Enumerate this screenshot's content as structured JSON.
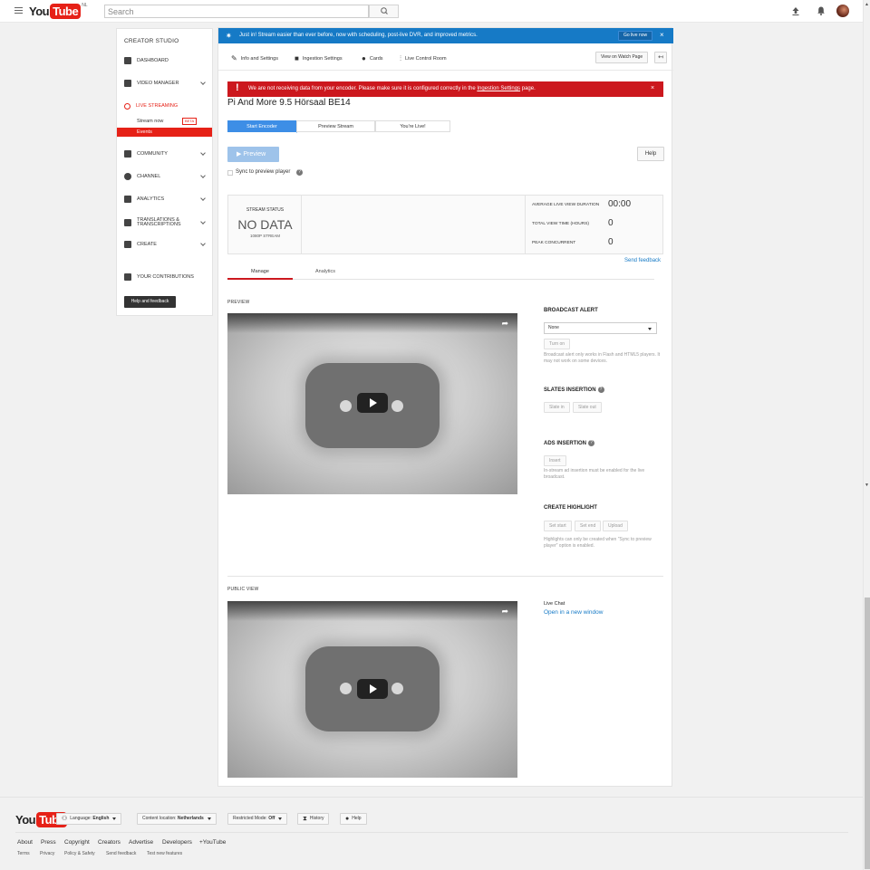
{
  "header": {
    "logo_you": "You",
    "logo_tube": "Tube",
    "logo_region": "NL",
    "search_placeholder": "Search"
  },
  "sidebar": {
    "title": "CREATOR STUDIO",
    "items": [
      {
        "label": "DASHBOARD"
      },
      {
        "label": "VIDEO MANAGER"
      },
      {
        "label": "LIVE STREAMING"
      },
      {
        "label": "COMMUNITY"
      },
      {
        "label": "CHANNEL"
      },
      {
        "label": "ANALYTICS"
      },
      {
        "label": "TRANSLATIONS &"
      },
      {
        "label": "TRANSCRIPTIONS"
      },
      {
        "label": "CREATE"
      },
      {
        "label": "YOUR CONTRIBUTIONS"
      }
    ],
    "sub_items": [
      {
        "label": "Stream now",
        "badge": "BETA"
      },
      {
        "label": "Events"
      }
    ],
    "help_button": "Help and feedback"
  },
  "announcement": {
    "text": "Just in! Stream easier than ever before, now with scheduling, post-live DVR, and improved metrics.",
    "button": "Go live now",
    "close": "×"
  },
  "toolbar": {
    "items": [
      {
        "label": "Info and Settings"
      },
      {
        "label": "Ingestion Settings"
      },
      {
        "label": "Cards"
      },
      {
        "label": "Live Control Room"
      }
    ],
    "view_watch": "View on Watch Page"
  },
  "error": {
    "text_before": "We are not receiving data from your encoder. Please make sure it is configured correctly in the ",
    "link": "Ingestion Settings",
    "text_after": " page.",
    "close": "×"
  },
  "stream": {
    "title": "Pi And More 9.5 Hörsaal BE14",
    "steps": [
      "Start Encoder",
      "Preview Stream",
      "You're Live!"
    ],
    "preview_button": "Preview",
    "help_button": "Help",
    "sync_label": "Sync to preview player"
  },
  "status": {
    "label": "STREAM STATUS",
    "value": "NO DATA",
    "resolution": "1080P STREAM",
    "stats": [
      {
        "label": "AVERAGE LIVE VIEW DURATION",
        "value": "00:00"
      },
      {
        "label": "TOTAL VIEW TIME (HOURS)",
        "value": "0"
      },
      {
        "label": "PEAK CONCURRENT",
        "value": "0"
      }
    ],
    "send_feedback": "Send feedback"
  },
  "tabs": [
    "Manage",
    "Analytics"
  ],
  "preview_section": {
    "label": "PREVIEW",
    "public_label": "PUBLIC VIEW"
  },
  "broadcast_alert": {
    "title": "BROADCAST ALERT",
    "selected": "None",
    "button": "Turn on",
    "note": "Broadcast alert only works in Flash and HTML5 players. It may not work on some devices."
  },
  "slates": {
    "title": "SLATES INSERTION",
    "buttons": [
      "Slate in",
      "Slate out"
    ]
  },
  "ads": {
    "title": "ADS INSERTION",
    "button": "Insert",
    "note": "In-stream ad insertion must be enabled for the live broadcast."
  },
  "highlight": {
    "title": "CREATE HIGHLIGHT",
    "buttons": [
      "Set start",
      "Set end",
      "Upload"
    ],
    "note": "Highlights can only be created when \"Sync to preview player\" option is enabled."
  },
  "live_chat": {
    "label": "Live Chat",
    "link": "Open in a new window"
  },
  "footer": {
    "language_prefix": "Language:",
    "language": "English",
    "location_prefix": "Content location:",
    "location": "Netherlands",
    "restricted_prefix": "Restricted Mode:",
    "restricted": "Off",
    "history": "History",
    "help": "Help",
    "links": [
      "About",
      "Press",
      "Copyright",
      "Creators",
      "Advertise",
      "Developers",
      "+YouTube"
    ],
    "small_links": [
      "Terms",
      "Privacy",
      "Policy & Safety",
      "Send feedback",
      "Test new features"
    ]
  },
  "colors": {
    "brand_red": "#e62117",
    "blue": "#167ac6",
    "error_red": "#cc181e"
  }
}
